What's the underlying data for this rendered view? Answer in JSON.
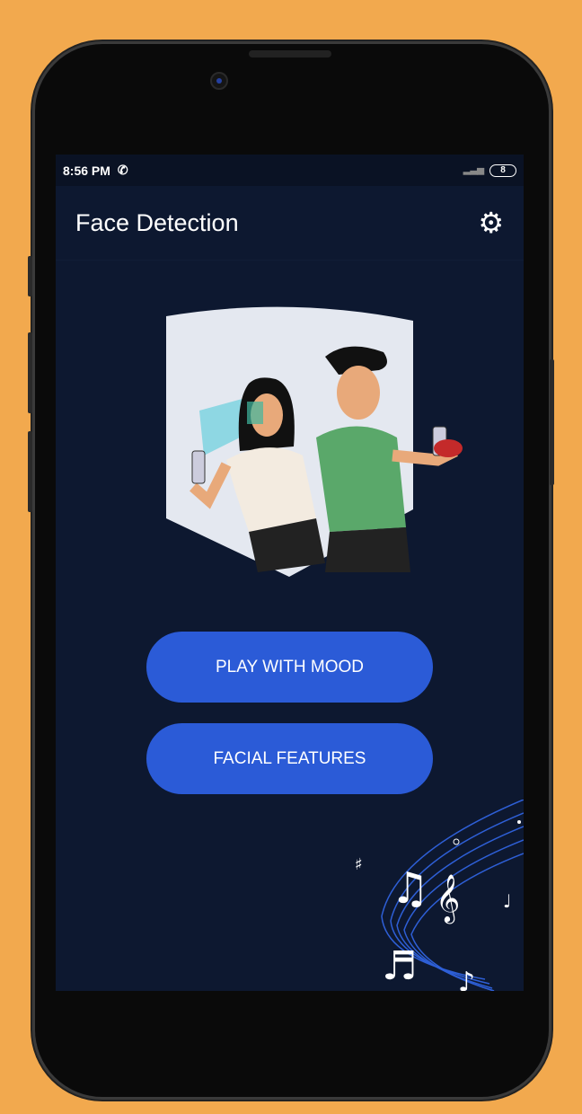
{
  "status_bar": {
    "time": "8:56 PM",
    "battery": "8"
  },
  "app_bar": {
    "title": "Face Detection",
    "settings_icon": "gear-icon"
  },
  "buttons": {
    "play_with_mood": "PLAY WITH MOOD",
    "facial_features": "FACIAL FEATURES"
  },
  "colors": {
    "background": "#0d1830",
    "button": "#2b5bd7",
    "frame": "#f2a94e"
  }
}
